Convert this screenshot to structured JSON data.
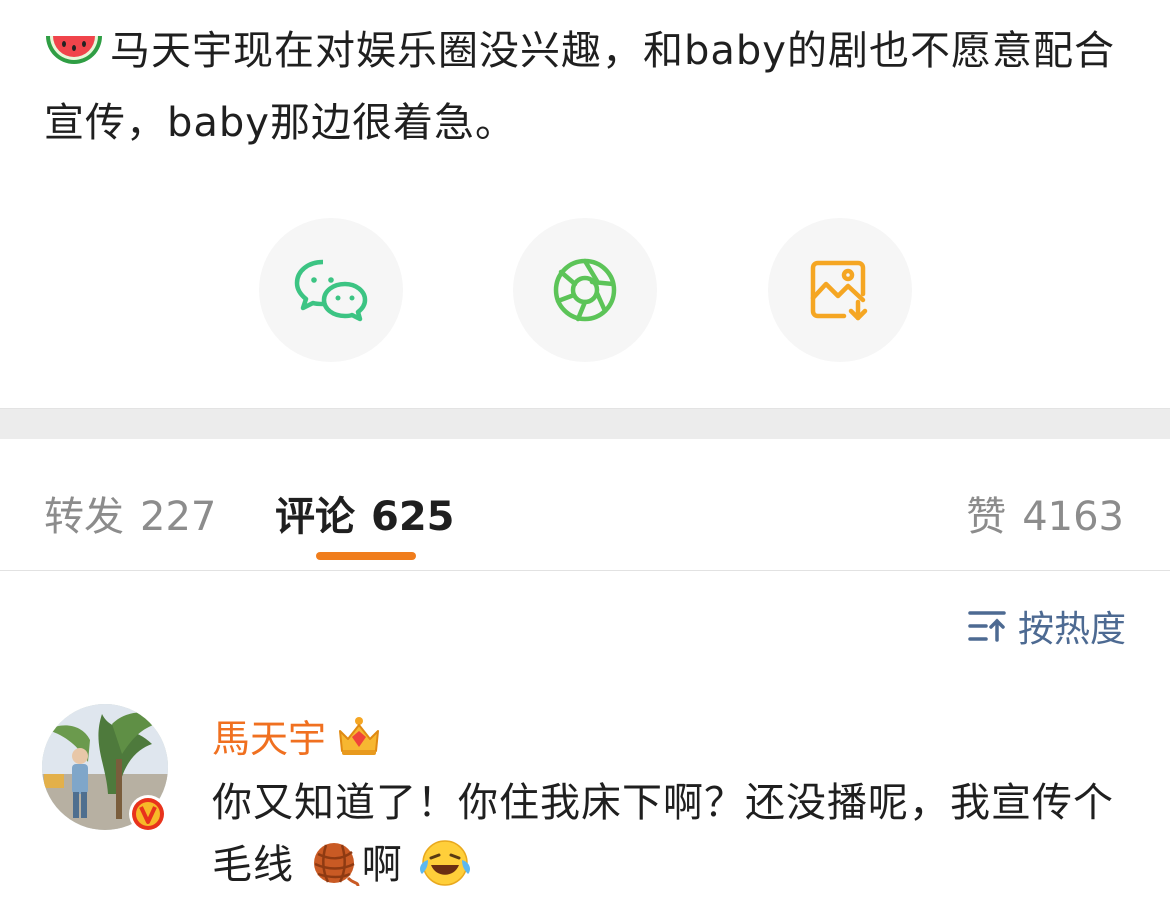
{
  "post": {
    "text": "马天宇现在对娱乐圈没兴趣，和baby的剧也不愿意配合宣传，baby那边很着急。",
    "leading_emoji": "watermelon-icon"
  },
  "share": {
    "items": [
      {
        "icon": "wechat-icon",
        "color": "#3cc483"
      },
      {
        "icon": "moments-icon",
        "color": "#5cc458"
      },
      {
        "icon": "save-image-icon",
        "color": "#f5a623"
      }
    ]
  },
  "tabs": {
    "repost_label": "转发",
    "repost_count": "227",
    "comment_label": "评论",
    "comment_count": "625",
    "like_label": "赞",
    "like_count": "4163",
    "accent": "#f07d1c"
  },
  "sort": {
    "label": "按热度",
    "icon": "sort-icon"
  },
  "comment": {
    "user": "馬天宇",
    "user_badge": "crown-icon",
    "verified": "verified-v-badge",
    "text_before": "你又知道了！你住我床下啊？还没播呢，我宣传个毛线",
    "text_after": "啊",
    "emojis": [
      "yarn-ball-icon",
      "laugh-cry-icon"
    ]
  }
}
